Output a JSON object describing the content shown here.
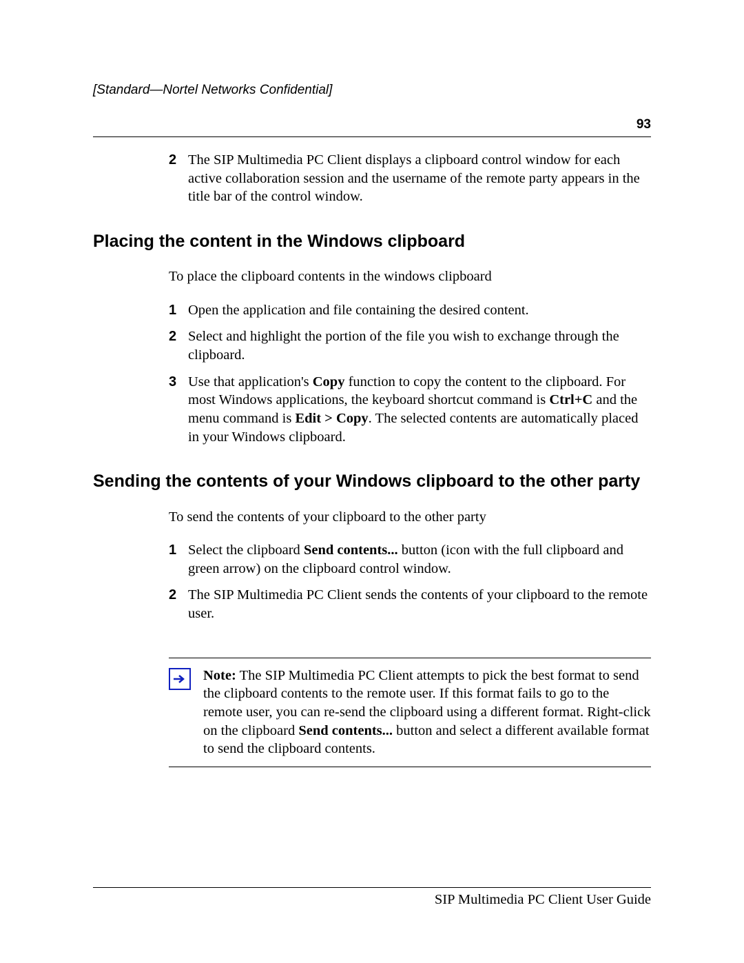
{
  "header": {
    "confidential": "[Standard—Nortel Networks Confidential]",
    "page_number": "93"
  },
  "top_list": {
    "item2": {
      "num": "2",
      "text": "The SIP Multimedia PC Client displays a clipboard control window for each active collaboration session and the username of the remote party appears in the title bar of the control window."
    }
  },
  "section1": {
    "heading": "Placing the content in the Windows clipboard",
    "intro": "To place the clipboard contents in the windows clipboard",
    "items": {
      "i1": {
        "num": "1",
        "text": "Open the application and file containing the desired content."
      },
      "i2": {
        "num": "2",
        "text": "Select and highlight the portion of the file you wish to exchange through the clipboard."
      },
      "i3": {
        "num": "3",
        "pre": "Use that application's ",
        "b1": "Copy",
        "mid1": " function to copy the content to the clipboard. For most Windows applications, the keyboard shortcut command is ",
        "b2": "Ctrl+C",
        "mid2": " and the menu command is ",
        "b3": "Edit > Copy",
        "post": ". The selected contents are automatically placed in your Windows clipboard."
      }
    }
  },
  "section2": {
    "heading": "Sending the contents of your Windows clipboard to the other party",
    "intro": "To send the contents of your clipboard to the other party",
    "items": {
      "i1": {
        "num": "1",
        "pre": "Select the clipboard ",
        "b1": "Send contents...",
        "post": " button (icon with the full clipboard and green arrow) on the clipboard control window."
      },
      "i2": {
        "num": "2",
        "text": "The SIP Multimedia PC Client sends the contents of your clipboard to the remote user."
      }
    }
  },
  "note": {
    "label": "Note:",
    "t1": " The SIP Multimedia PC Client attempts to pick the best format to send the clipboard contents to the remote user. If this format fails to go to the remote user, you can re-send the clipboard using a different format. Right-click on the clipboard ",
    "b1": "Send contents...",
    "t2": " button and select a different available format to send the clipboard contents."
  },
  "footer": {
    "text": "SIP Multimedia PC Client User Guide"
  }
}
